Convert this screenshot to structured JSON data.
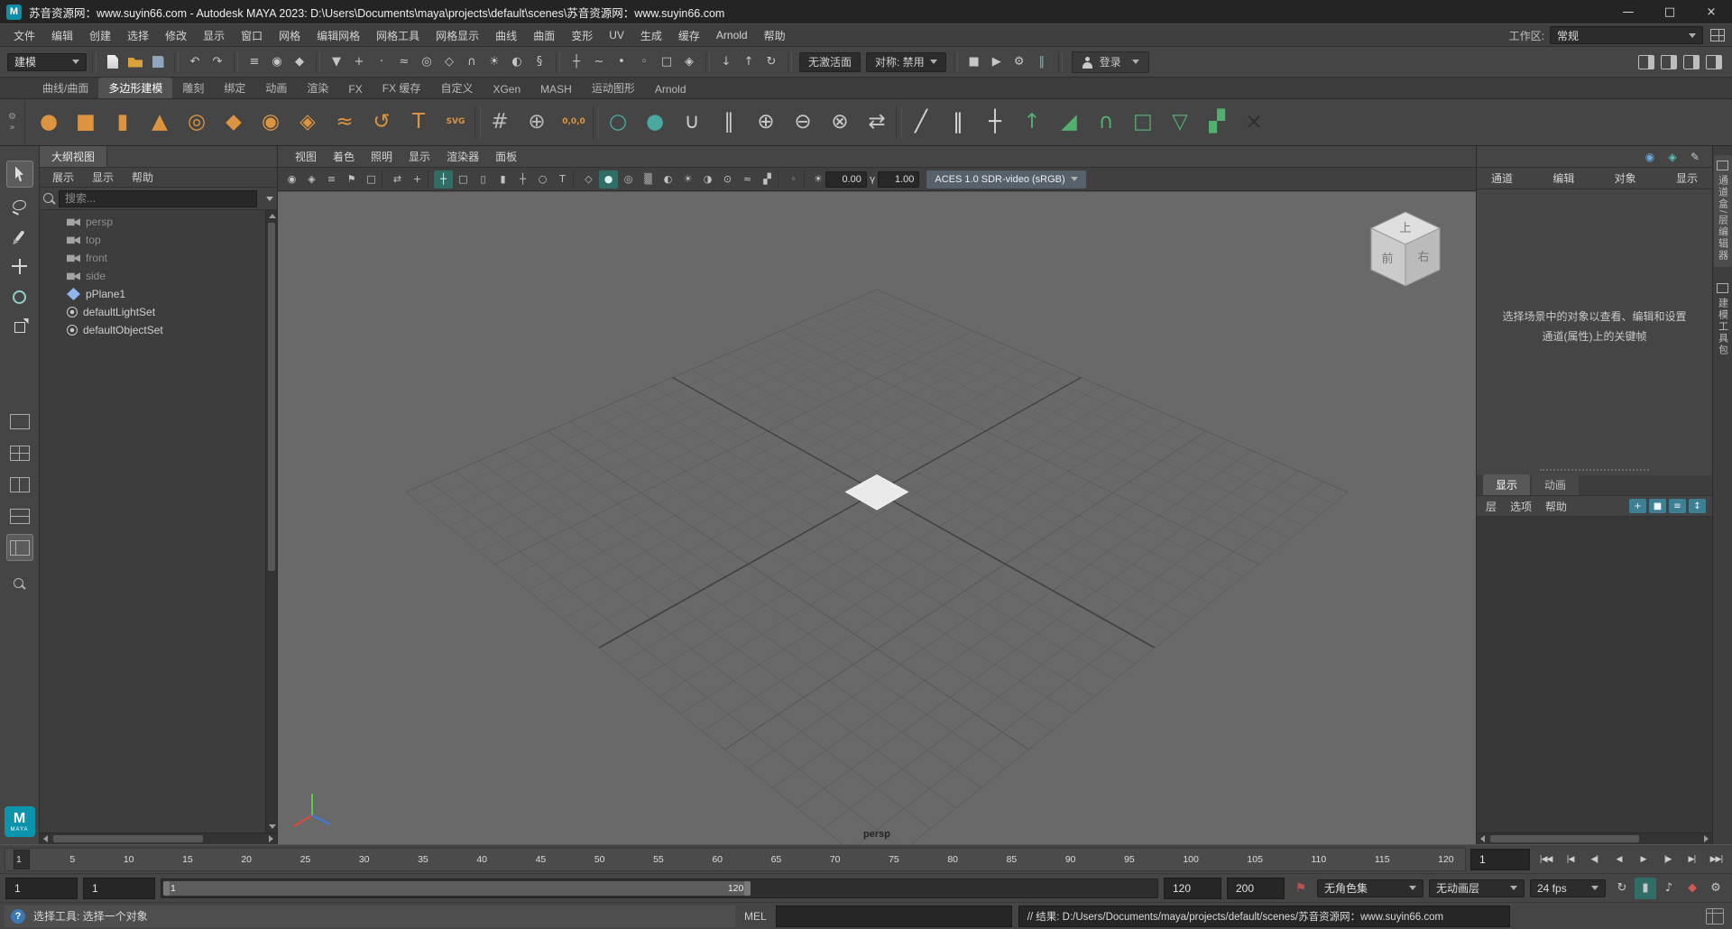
{
  "colors": {
    "viewport_bg": "#696969",
    "grid_line": "#5e5e5e",
    "grid_axis": "#424242",
    "shelf_orange": "#dd9440",
    "shelf_green": "#52b06e",
    "shelf_teal": "#49a8a0",
    "active_teal": "#2f6d66",
    "bookmark_red": "#c0504d",
    "maya_logo_blue": "#0d94ad"
  },
  "title_bar": {
    "app_icon_letter": "M",
    "app_title": "苏音资源网：www.suyin66.com - Autodesk MAYA 2023: D:\\Users\\Documents\\maya\\projects\\default\\scenes\\苏音资源网：www.suyin66.com",
    "controls": [
      {
        "name": "minimize-button",
        "glyph": "—"
      },
      {
        "name": "maximize-button",
        "glyph": "□"
      },
      {
        "name": "close-button",
        "glyph": "×"
      }
    ]
  },
  "menu_bar": {
    "items": [
      "文件",
      "编辑",
      "创建",
      "选择",
      "修改",
      "显示",
      "窗口",
      "网格",
      "编辑网格",
      "网格工具",
      "网格显示",
      "曲线",
      "曲面",
      "变形",
      "UV",
      "生成",
      "缓存",
      "Arnold",
      "帮助"
    ],
    "workspace_label": "工作区:",
    "workspace_value": "常规"
  },
  "status_line": {
    "menu_set": "建模",
    "file_icons": [
      {
        "name": "new-scene-icon"
      },
      {
        "name": "open-scene-icon"
      },
      {
        "name": "save-scene-icon"
      }
    ],
    "undo_icons": [
      {
        "name": "undo-icon",
        "glyph": "↶"
      },
      {
        "name": "redo-icon",
        "glyph": "↷"
      }
    ],
    "selection_mode_icons": [
      {
        "name": "select-hierarchy-icon",
        "glyph": "≡"
      },
      {
        "name": "select-object-icon",
        "glyph": "◉"
      },
      {
        "name": "select-component-icon",
        "glyph": "◆"
      }
    ],
    "mask_icons": [
      {
        "name": "mask-all-icon",
        "glyph": "▼"
      },
      {
        "name": "mask-handles-icon",
        "glyph": "+"
      },
      {
        "name": "mask-points-icon",
        "glyph": "·"
      },
      {
        "name": "mask-curves-icon",
        "glyph": "≈"
      },
      {
        "name": "mask-surfaces-icon",
        "glyph": "◎"
      },
      {
        "name": "mask-deformations-icon",
        "glyph": "◇"
      },
      {
        "name": "mask-joints-icon",
        "glyph": "∩"
      },
      {
        "name": "mask-dynamics-icon",
        "glyph": "☀"
      },
      {
        "name": "mask-rendering-icon",
        "glyph": "◐"
      },
      {
        "name": "mask-misc-icon",
        "glyph": "§"
      }
    ],
    "snap_icons": [
      {
        "name": "snap-grid-icon",
        "glyph": "┼"
      },
      {
        "name": "snap-curve-icon",
        "glyph": "~"
      },
      {
        "name": "snap-point-icon",
        "glyph": "•"
      },
      {
        "name": "snap-projected-center-icon",
        "glyph": "◦"
      },
      {
        "name": "snap-view-plane-icon",
        "glyph": "□"
      },
      {
        "name": "make-live-icon",
        "glyph": "◈"
      }
    ],
    "history_icons": [
      {
        "name": "input-connections-icon",
        "glyph": "↓"
      },
      {
        "name": "output-connections-icon",
        "glyph": "↑"
      },
      {
        "name": "construction-history-icon",
        "glyph": "↻"
      }
    ],
    "no_live_surface": "无激活面",
    "symmetry": "对称: 禁用",
    "render_icons": [
      {
        "name": "render-current-frame-icon",
        "glyph": "■"
      },
      {
        "name": "ipr-render-icon",
        "glyph": "▶"
      },
      {
        "name": "render-settings-icon",
        "glyph": "⚙"
      },
      {
        "name": "pause-viewport-icon",
        "glyph": "‖",
        "color": "#5bc0c0"
      }
    ],
    "login_label": "登录",
    "sidebar_toggles": [
      {
        "name": "attribute-editor-toggle-icon"
      },
      {
        "name": "tool-settings-toggle-icon"
      },
      {
        "name": "channel-box-toggle-icon"
      },
      {
        "name": "modeling-toolkit-toggle-icon"
      }
    ]
  },
  "shelf": {
    "tabs": [
      {
        "label": "曲线/曲面"
      },
      {
        "label": "多边形建模",
        "active": true
      },
      {
        "label": "雕刻"
      },
      {
        "label": "绑定"
      },
      {
        "label": "动画"
      },
      {
        "label": "渲染"
      },
      {
        "label": "FX"
      },
      {
        "label": "FX 缓存"
      },
      {
        "label": "自定义"
      },
      {
        "label": "XGen"
      },
      {
        "label": "MASH"
      },
      {
        "label": "运动图形"
      },
      {
        "label": "Arnold"
      }
    ],
    "controls": [
      {
        "name": "shelf-gear-icon",
        "glyph": "⚙"
      },
      {
        "name": "shelf-overflow-icon",
        "glyph": "»"
      }
    ],
    "icons": [
      {
        "name": "poly-sphere-icon",
        "glyph": "●",
        "color": "#dd9440"
      },
      {
        "name": "poly-cube-icon",
        "glyph": "■",
        "color": "#dd9440"
      },
      {
        "name": "poly-cylinder-icon",
        "glyph": "▮",
        "color": "#dd9440"
      },
      {
        "name": "poly-cone-icon",
        "glyph": "▲",
        "color": "#dd9440"
      },
      {
        "name": "poly-torus-icon",
        "glyph": "◎",
        "color": "#dd9440"
      },
      {
        "name": "poly-plane-icon",
        "glyph": "◆",
        "color": "#dd9440"
      },
      {
        "name": "poly-disc-icon",
        "glyph": "◉",
        "color": "#dd9440"
      },
      {
        "name": "poly-platonic-icon",
        "glyph": "◈",
        "color": "#dd9440"
      },
      {
        "name": "sweep-mesh-icon",
        "glyph": "≈",
        "color": "#dd9440"
      },
      {
        "name": "curve-spiral-icon",
        "glyph": "↺",
        "color": "#dd9440"
      },
      {
        "name": "type-text-icon",
        "glyph": "T",
        "color": "#dd9440"
      },
      {
        "name": "svg-tool-icon",
        "glyph": "SVG",
        "color": "#dd9440",
        "small": true
      },
      {
        "name": "shelf-separator"
      },
      {
        "name": "construction-plane-icon",
        "glyph": "#",
        "color": "#b9b9b9"
      },
      {
        "name": "center-pivot-icon",
        "glyph": "⊕",
        "color": "#b9b9b9"
      },
      {
        "name": "snap-to-origin-icon",
        "glyph": "0,0,0",
        "color": "#dd9440",
        "small": true
      },
      {
        "name": "shelf-separator"
      },
      {
        "name": "smooth-mesh-preview-icon",
        "glyph": "○",
        "color": "#49a8a0"
      },
      {
        "name": "subdiv-proxy-icon",
        "glyph": "●",
        "color": "#49a8a0"
      },
      {
        "name": "combine-icon",
        "glyph": "∪",
        "color": "#c9c9c9"
      },
      {
        "name": "separate-icon",
        "glyph": "∥",
        "color": "#c9c9c9"
      },
      {
        "name": "boolean-union-icon",
        "glyph": "⊕",
        "color": "#c9c9c9"
      },
      {
        "name": "boolean-difference-icon",
        "glyph": "⊖",
        "color": "#c9c9c9"
      },
      {
        "name": "boolean-intersection-icon",
        "glyph": "⊗",
        "color": "#c9c9c9"
      },
      {
        "name": "mirror-icon",
        "glyph": "⇄",
        "color": "#c9c9c9"
      },
      {
        "name": "shelf-separator"
      },
      {
        "name": "multi-cut-icon",
        "glyph": "╱",
        "color": "#d8d8d8"
      },
      {
        "name": "insert-edge-loop-icon",
        "glyph": "‖",
        "color": "#d8d8d8"
      },
      {
        "name": "offset-edge-loop-icon",
        "glyph": "┼",
        "color": "#d8d8d8"
      },
      {
        "name": "extrude-icon",
        "glyph": "↑",
        "color": "#52b06e"
      },
      {
        "name": "bevel-icon",
        "glyph": "◢",
        "color": "#52b06e"
      },
      {
        "name": "bridge-icon",
        "glyph": "∩",
        "color": "#52b06e"
      },
      {
        "name": "fill-hole-icon",
        "glyph": "□",
        "color": "#52b06e"
      },
      {
        "name": "reduce-icon",
        "glyph": "▽",
        "color": "#52b06e"
      },
      {
        "name": "quad-draw-icon",
        "glyph": "▞",
        "color": "#52b06e"
      },
      {
        "name": "cut-tool-icon",
        "glyph": "×",
        "color": "#2f2f2f"
      }
    ]
  },
  "toolbox": {
    "tools": [
      {
        "name": "select-tool",
        "active": true
      },
      {
        "name": "lasso-tool"
      },
      {
        "name": "paint-select-tool"
      },
      {
        "name": "move-tool"
      },
      {
        "name": "rotate-tool"
      },
      {
        "name": "scale-tool"
      }
    ],
    "layouts": [
      {
        "name": "layout-single-pane"
      },
      {
        "name": "layout-four-pane"
      },
      {
        "name": "layout-two-pane"
      },
      {
        "name": "layout-three-pane"
      },
      {
        "name": "layout-outliner-persp",
        "active": true
      }
    ],
    "maya_badge_letter": "M",
    "maya_badge_word": "MAYA"
  },
  "outliner": {
    "tab_label": "大纲视图",
    "menus": [
      "展示",
      "显示",
      "帮助"
    ],
    "search_placeholder": "搜索...",
    "items": [
      {
        "label": "persp",
        "icon": "camera",
        "dim": true
      },
      {
        "label": "top",
        "icon": "camera",
        "dim": true
      },
      {
        "label": "front",
        "icon": "camera",
        "dim": true
      },
      {
        "label": "side",
        "icon": "camera",
        "dim": true
      },
      {
        "label": "pPlane1",
        "icon": "mesh"
      },
      {
        "label": "defaultLightSet",
        "icon": "set"
      },
      {
        "label": "defaultObjectSet",
        "icon": "set"
      }
    ]
  },
  "viewport": {
    "menus": [
      "视图",
      "着色",
      "照明",
      "显示",
      "渲染器",
      "面板"
    ],
    "toolbar_icons": [
      {
        "name": "select-camera-icon",
        "glyph": "◉"
      },
      {
        "name": "lock-camera-icon",
        "glyph": "◈"
      },
      {
        "name": "camera-attributes-icon",
        "glyph": "≡"
      },
      {
        "name": "bookmark-view-icon",
        "glyph": "⚑"
      },
      {
        "name": "image-plane-icon",
        "glyph": "□"
      },
      {
        "name": "vp-separator"
      },
      {
        "name": "2d-pan-zoom-icon",
        "glyph": "⇄"
      },
      {
        "name": "joystick-controls-icon",
        "glyph": "+"
      },
      {
        "name": "vp-separator"
      },
      {
        "name": "grid-toggle-icon",
        "glyph": "┼",
        "active": true
      },
      {
        "name": "film-gate-icon",
        "glyph": "□"
      },
      {
        "name": "resolution-gate-icon",
        "glyph": "▯"
      },
      {
        "name": "gate-mask-icon",
        "glyph": "▮"
      },
      {
        "name": "field-chart-icon",
        "glyph": "┼"
      },
      {
        "name": "safe-action-icon",
        "glyph": "○"
      },
      {
        "name": "safe-title-icon",
        "glyph": "T"
      },
      {
        "name": "vp-separator"
      },
      {
        "name": "wireframe-icon",
        "glyph": "◇"
      },
      {
        "name": "smooth-shade-all-icon",
        "glyph": "●",
        "active": true
      },
      {
        "name": "wireframe-on-shaded-icon",
        "glyph": "◎"
      },
      {
        "name": "textured-icon",
        "glyph": "▒"
      },
      {
        "name": "use-default-material-icon",
        "glyph": "◐"
      },
      {
        "name": "lighting-icon",
        "glyph": "☀"
      },
      {
        "name": "shadows-icon",
        "glyph": "◑"
      },
      {
        "name": "screen-space-ao-icon",
        "glyph": "⊙"
      },
      {
        "name": "motion-blur-icon",
        "glyph": "≈"
      },
      {
        "name": "anti-alias-icon",
        "glyph": "▞"
      },
      {
        "name": "vp-separator"
      },
      {
        "name": "isolate-select-icon",
        "glyph": "◦"
      },
      {
        "name": "vp-separator"
      }
    ],
    "exposure_icon": "☀",
    "exposure": "0.00",
    "gamma_icon": "γ",
    "gamma": "1.00",
    "colorspace": "ACES 1.0 SDR-video (sRGB)",
    "camera_label": "persp",
    "view_cube": {
      "top": "上",
      "front": "前",
      "right": "右"
    }
  },
  "right_panel": {
    "corner_icons": [
      {
        "name": "person-icon",
        "glyph": "◉"
      },
      {
        "name": "camera-icon",
        "glyph": "◈"
      },
      {
        "name": "pencil-icon",
        "glyph": "✎"
      }
    ],
    "channel_menus": [
      "通道",
      "编辑",
      "对象",
      "显示"
    ],
    "hint_text": "选择场景中的对象以查看、编辑和设置通道(属性)上的关键帧",
    "layer_tabs": [
      {
        "label": "显示",
        "active": true
      },
      {
        "label": "动画"
      }
    ],
    "layer_menus": [
      "层",
      "选项",
      "帮助"
    ],
    "layer_icons": [
      {
        "name": "new-empty-layer-icon",
        "glyph": "+"
      },
      {
        "name": "new-layer-from-selected-icon",
        "glyph": "■"
      },
      {
        "name": "layer-options-icon",
        "glyph": "≡"
      },
      {
        "name": "sort-layers-icon",
        "glyph": "↕"
      }
    ],
    "side_tabs": [
      {
        "label": "通道盒/层编辑器",
        "active": true
      },
      {
        "label": "建模工具包"
      }
    ]
  },
  "timeline": {
    "ticks": [
      "1",
      "5",
      "10",
      "15",
      "20",
      "25",
      "30",
      "35",
      "40",
      "45",
      "50",
      "55",
      "60",
      "65",
      "70",
      "75",
      "80",
      "85",
      "90",
      "95",
      "100",
      "105",
      "110",
      "115",
      "120"
    ],
    "current_frame": "1",
    "playback": [
      {
        "name": "go-to-start-button",
        "glyph": "|◀◀"
      },
      {
        "name": "step-back-frame-button",
        "glyph": "|◀"
      },
      {
        "name": "step-back-key-button",
        "glyph": "◀|"
      },
      {
        "name": "play-backwards-button",
        "glyph": "◀"
      },
      {
        "name": "play-forwards-button",
        "glyph": "▶"
      },
      {
        "name": "step-forward-key-button",
        "glyph": "|▶"
      },
      {
        "name": "step-forward-frame-button",
        "glyph": "▶|"
      },
      {
        "name": "go-to-end-button",
        "glyph": "▶▶|"
      }
    ]
  },
  "range": {
    "animation_start": "1",
    "playback_start": "1",
    "range_start_label": "1",
    "range_end_label": "120",
    "playback_end": "120",
    "animation_end": "200",
    "bookmark_glyph": "⚑",
    "character_set": "无角色集",
    "animation_layer": "无动画层",
    "framerate": "24 fps",
    "icons": [
      {
        "name": "loop-mode-icon",
        "glyph": "↻"
      },
      {
        "name": "cached-playback-icon",
        "glyph": "▮",
        "active": true
      },
      {
        "name": "mute-audio-icon",
        "glyph": "♪"
      },
      {
        "name": "auto-keyframe-icon",
        "glyph": "◆",
        "color": "#cf5a52"
      },
      {
        "name": "animation-preferences-icon",
        "glyph": "⚙"
      }
    ]
  },
  "bottom_bar": {
    "help_icon": "?",
    "help_text": "选择工具: 选择一个对象",
    "mel_label": "MEL",
    "command_value": "",
    "result_text": "// 结果: D:/Users/Documents/maya/projects/default/scenes/苏音资源网：www.suyin66.com"
  }
}
